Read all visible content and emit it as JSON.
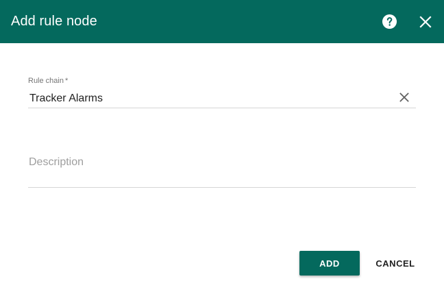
{
  "dialog": {
    "title": "Add rule node",
    "header_color": "#04695d",
    "help_icon": "help-circle-icon",
    "close_icon": "close-icon"
  },
  "form": {
    "rule_chain": {
      "label": "Rule chain",
      "required_mark": "*",
      "value": "Tracker Alarms",
      "clear_icon": "clear-icon"
    },
    "description": {
      "placeholder": "Description",
      "value": ""
    }
  },
  "actions": {
    "add_label": "ADD",
    "cancel_label": "CANCEL",
    "accent_color": "#04695d"
  }
}
